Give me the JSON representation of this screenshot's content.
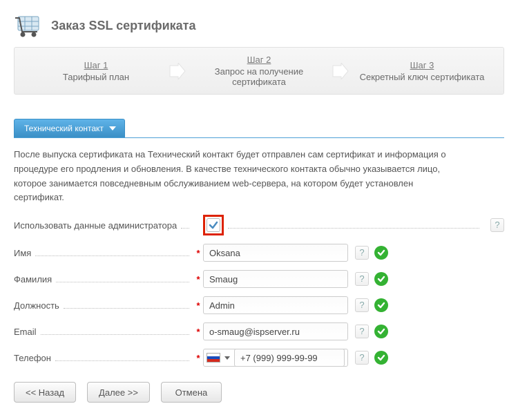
{
  "header": {
    "title": "Заказ SSL сертификата"
  },
  "steps": {
    "items": [
      {
        "num": "Шаг 1",
        "label": "Тарифный план"
      },
      {
        "num": "Шаг 2",
        "label": "Запрос на получение сертификата"
      },
      {
        "num": "Шаг 3",
        "label": "Секретный ключ сертификата"
      }
    ]
  },
  "tab": {
    "label": "Технический контакт"
  },
  "description": "После выпуска сертификата на Технический контакт будет отправлен сам сертификат и информация о процедуре его продления и обновления. В качестве технического контакта обычно указывается лицо, которое занимается повседневным обслуживанием web-сервера, на котором будет установлен сертификат.",
  "form": {
    "useAdmin": {
      "label": "Использовать данные администратора",
      "checked": true
    },
    "name": {
      "label": "Имя",
      "value": "Oksana"
    },
    "surname": {
      "label": "Фамилия",
      "value": "Smaug"
    },
    "position": {
      "label": "Должность",
      "value": "Admin"
    },
    "email": {
      "label": "Email",
      "value": "o-smaug@ispserver.ru"
    },
    "phone": {
      "label": "Телефон",
      "value": "+7 (999) 999-99-99",
      "country": "ru"
    }
  },
  "buttons": {
    "back": "<< Назад",
    "next": "Далее >>",
    "cancel": "Отмена"
  },
  "colors": {
    "accent": "#4ea0d6",
    "success": "#34b233",
    "highlight": "#d20"
  },
  "glyphs": {
    "help": "?"
  }
}
